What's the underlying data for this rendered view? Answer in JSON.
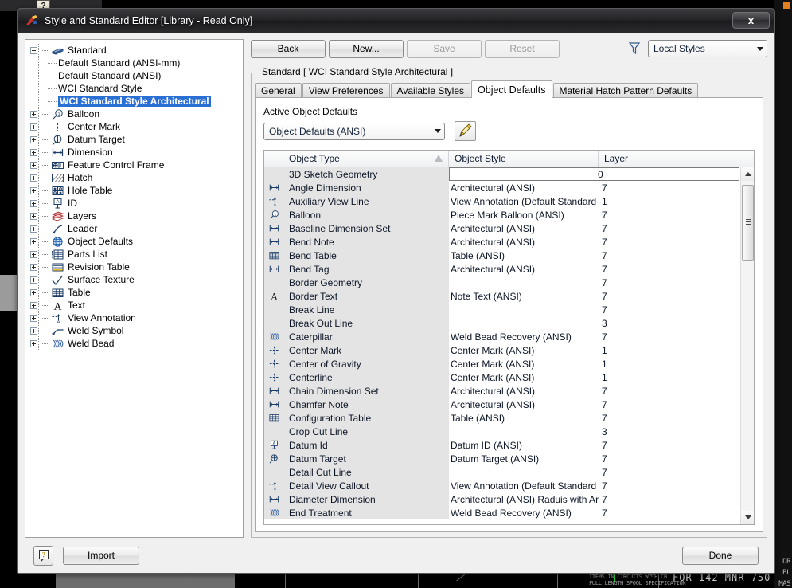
{
  "window": {
    "title": "Style and Standard Editor [Library - Read Only]",
    "close_label": "x",
    "app_icon": "autodesk-inventor-icon"
  },
  "tree": {
    "root": {
      "label": "Standard",
      "icon": "book-icon",
      "expanded": true
    },
    "children": [
      {
        "label": "Default Standard (ANSI-mm)"
      },
      {
        "label": "Default Standard (ANSI)"
      },
      {
        "label": "WCI Standard Style"
      },
      {
        "label": "WCI Standard Style Architectural",
        "selected": true
      }
    ],
    "categories": [
      {
        "label": "Balloon",
        "icon": "balloon-icon"
      },
      {
        "label": "Center Mark",
        "icon": "center-mark-icon"
      },
      {
        "label": "Datum Target",
        "icon": "datum-target-icon"
      },
      {
        "label": "Dimension",
        "icon": "dimension-icon"
      },
      {
        "label": "Feature Control Frame",
        "icon": "feature-control-frame-icon"
      },
      {
        "label": "Hatch",
        "icon": "hatch-icon"
      },
      {
        "label": "Hole Table",
        "icon": "hole-table-icon"
      },
      {
        "label": "ID",
        "icon": "id-icon"
      },
      {
        "label": "Layers",
        "icon": "layers-icon"
      },
      {
        "label": "Leader",
        "icon": "leader-icon"
      },
      {
        "label": "Object Defaults",
        "icon": "object-defaults-icon"
      },
      {
        "label": "Parts List",
        "icon": "parts-list-icon"
      },
      {
        "label": "Revision Table",
        "icon": "revision-table-icon"
      },
      {
        "label": "Surface Texture",
        "icon": "surface-texture-icon"
      },
      {
        "label": "Table",
        "icon": "table-icon"
      },
      {
        "label": "Text",
        "icon": "text-icon"
      },
      {
        "label": "View Annotation",
        "icon": "view-annotation-icon"
      },
      {
        "label": "Weld Symbol",
        "icon": "weld-symbol-icon"
      },
      {
        "label": "Weld Bead",
        "icon": "weld-bead-icon"
      }
    ]
  },
  "toolbar": {
    "back": "Back",
    "new": "New...",
    "save": "Save",
    "reset": "Reset",
    "filter_icon": "funnel-icon",
    "style_filter_value": "Local Styles"
  },
  "group": {
    "legend": "Standard [ WCI Standard Style Architectural ]"
  },
  "tabs": [
    {
      "label": "General",
      "active": false
    },
    {
      "label": "View Preferences",
      "active": false
    },
    {
      "label": "Available Styles",
      "active": false
    },
    {
      "label": "Object Defaults",
      "active": true
    },
    {
      "label": "Material Hatch Pattern Defaults",
      "active": false
    }
  ],
  "active_defaults": {
    "label": "Active Object Defaults",
    "value": "Object Defaults (ANSI)",
    "edit_icon": "pencil-icon"
  },
  "grid": {
    "columns": [
      "Object Type",
      "Object Style",
      "Layer"
    ],
    "sort_column": "Object Type",
    "rows": [
      {
        "icon": "",
        "type": "3D Sketch Geometry",
        "style": "",
        "layer": "0",
        "editing": true
      },
      {
        "icon": "dimension-icon",
        "type": "Angle Dimension",
        "style": "Architectural (ANSI)",
        "layer": "7"
      },
      {
        "icon": "view-annotation-icon",
        "type": "Auxiliary View Line",
        "style": "View Annotation (Default Standard (A",
        "layer": "1"
      },
      {
        "icon": "balloon-icon",
        "type": "Balloon",
        "style": "Piece Mark Balloon (ANSI)",
        "layer": "7"
      },
      {
        "icon": "dimension-icon",
        "type": "Baseline Dimension Set",
        "style": "Architectural (ANSI)",
        "layer": "7"
      },
      {
        "icon": "dimension-icon",
        "type": "Bend Note",
        "style": "Architectural (ANSI)",
        "layer": "7"
      },
      {
        "icon": "table-icon",
        "type": "Bend Table",
        "style": "Table (ANSI)",
        "layer": "7"
      },
      {
        "icon": "dimension-icon",
        "type": "Bend Tag",
        "style": "Architectural (ANSI)",
        "layer": "7"
      },
      {
        "icon": "",
        "type": "Border Geometry",
        "style": "",
        "layer": "7"
      },
      {
        "icon": "text-icon",
        "type": "Border Text",
        "style": "Note Text (ANSI)",
        "layer": "7"
      },
      {
        "icon": "",
        "type": "Break Line",
        "style": "",
        "layer": "7"
      },
      {
        "icon": "",
        "type": "Break Out Line",
        "style": "",
        "layer": "3"
      },
      {
        "icon": "weld-bead-icon",
        "type": "Caterpillar",
        "style": "Weld Bead Recovery (ANSI)",
        "layer": "7"
      },
      {
        "icon": "center-mark-icon",
        "type": "Center Mark",
        "style": "Center Mark (ANSI)",
        "layer": "1"
      },
      {
        "icon": "center-mark-icon",
        "type": "Center of Gravity",
        "style": "Center Mark (ANSI)",
        "layer": "1"
      },
      {
        "icon": "center-mark-icon",
        "type": "Centerline",
        "style": "Center Mark (ANSI)",
        "layer": "1"
      },
      {
        "icon": "dimension-icon",
        "type": "Chain Dimension Set",
        "style": "Architectural (ANSI)",
        "layer": "7"
      },
      {
        "icon": "dimension-icon",
        "type": "Chamfer Note",
        "style": "Architectural (ANSI)",
        "layer": "7"
      },
      {
        "icon": "table-icon",
        "type": "Configuration Table",
        "style": "Table (ANSI)",
        "layer": "7"
      },
      {
        "icon": "",
        "type": "Crop Cut Line",
        "style": "",
        "layer": "3"
      },
      {
        "icon": "id-icon",
        "type": "Datum Id",
        "style": "Datum ID (ANSI)",
        "layer": "7"
      },
      {
        "icon": "datum-target-icon",
        "type": "Datum Target",
        "style": "Datum Target (ANSI)",
        "layer": "7"
      },
      {
        "icon": "",
        "type": "Detail Cut Line",
        "style": "",
        "layer": "7"
      },
      {
        "icon": "view-annotation-icon",
        "type": "Detail View Callout",
        "style": "View Annotation (Default Standard (A",
        "layer": "7"
      },
      {
        "icon": "dimension-icon",
        "type": "Diameter Dimension",
        "style": "Architectural (ANSI) Raduis with Arro",
        "layer": "7"
      },
      {
        "icon": "weld-bead-icon",
        "type": "End Treatment",
        "style": "Weld Bead Recovery (ANSI)",
        "layer": "7"
      }
    ]
  },
  "footer": {
    "help": "?",
    "import": "Import",
    "done": "Done"
  },
  "background": {
    "right_labels": [
      "DR",
      "BL",
      "MAS"
    ],
    "drawing_texts": [
      "ITEMS IN CIRCUITS WITH CB",
      "FULL LENGTH SPOOL   SPECIFICATION",
      "FOR 142  MNR 750"
    ]
  },
  "colors": {
    "selection_blue": "#2a6fd4",
    "title_dark": "#232326",
    "dialog_face": "#f0f0f0",
    "grid_rowhead": "#e4e4e4",
    "accent_yellow": "#f5c842"
  }
}
